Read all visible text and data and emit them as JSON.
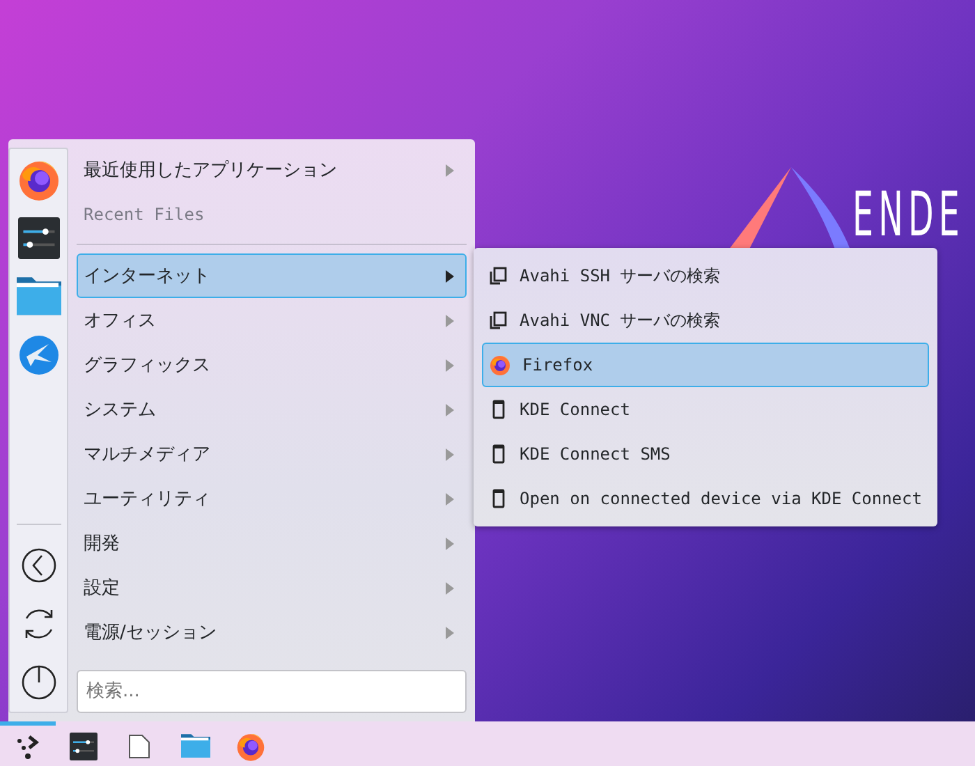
{
  "wallpaper": {
    "logo_text": "ENDE"
  },
  "menu": {
    "items": [
      {
        "kind": "submenu",
        "label": "最近使用したアプリケーション",
        "selected": false
      },
      {
        "kind": "disabled",
        "label": "Recent Files",
        "selected": false
      },
      {
        "kind": "separator"
      },
      {
        "kind": "submenu",
        "label": "インターネット",
        "selected": true
      },
      {
        "kind": "submenu",
        "label": "オフィス",
        "selected": false
      },
      {
        "kind": "submenu",
        "label": "グラフィックス",
        "selected": false
      },
      {
        "kind": "submenu",
        "label": "システム",
        "selected": false
      },
      {
        "kind": "submenu",
        "label": "マルチメディア",
        "selected": false
      },
      {
        "kind": "submenu",
        "label": "ユーティリティ",
        "selected": false
      },
      {
        "kind": "submenu",
        "label": "開発",
        "selected": false
      },
      {
        "kind": "submenu",
        "label": "設定",
        "selected": false
      },
      {
        "kind": "submenu",
        "label": "電源/セッション",
        "selected": false
      }
    ],
    "search": {
      "placeholder": "検索..."
    }
  },
  "submenu": {
    "items": [
      {
        "kind": "network",
        "label": "Avahi SSH サーバの検索",
        "selected": false
      },
      {
        "kind": "network",
        "label": "Avahi VNC サーバの検索",
        "selected": false
      },
      {
        "kind": "browser",
        "label": "Firefox",
        "selected": true
      },
      {
        "kind": "phone",
        "label": "KDE Connect",
        "selected": false
      },
      {
        "kind": "phone",
        "label": "KDE Connect SMS",
        "selected": false
      },
      {
        "kind": "phone",
        "label": "Open on connected device via KDE Connect",
        "selected": false
      }
    ]
  },
  "taskbar": {
    "items": [
      {
        "kind": "launcher",
        "selected": true
      },
      {
        "kind": "settings",
        "selected": false
      },
      {
        "kind": "file",
        "selected": false
      },
      {
        "kind": "folder",
        "selected": false
      },
      {
        "kind": "browser",
        "selected": false
      }
    ]
  }
}
